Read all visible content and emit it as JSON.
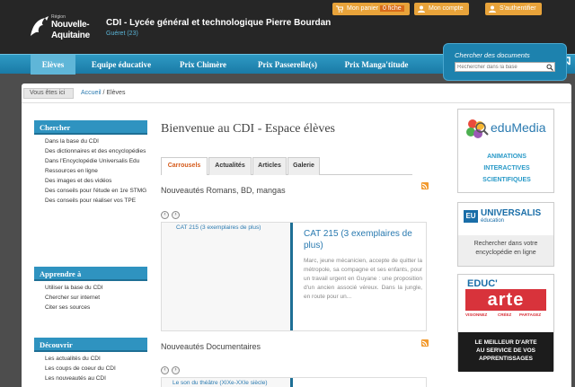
{
  "header": {
    "buttons": {
      "cart_label": "Mon panier",
      "cart_badge": "0 fiche",
      "account_label": "Mon compte",
      "login_label": "S'authentifier"
    },
    "logo": {
      "region_small": "Région",
      "region_line1": "Nouvelle-",
      "region_line2": "Aquitaine"
    },
    "title": "CDI - Lycée général et technologique Pierre Bourdan",
    "subtitle": "Guéret (23)"
  },
  "nav": {
    "items": [
      "Elèves",
      "Equipe éducative",
      "Prix Chimère",
      "Prix Passerelle(s)",
      "Prix Manga'titude"
    ]
  },
  "search": {
    "label": "Chercher des documents",
    "placeholder": "Rechercher dans la base"
  },
  "breadcrumb": {
    "here": "Vous êtes ici",
    "home": "Accueil",
    "separator": "/",
    "current": "Elèves"
  },
  "sidebar": {
    "chercher": {
      "title": "Chercher",
      "items": [
        "Dans la base du CDI",
        "Des dictionnaires et des encyclopédies",
        "Dans l'Encyclopédie Universalis Edu",
        "Ressources en ligne",
        "Des images et des vidéos",
        "Des conseils pour l'étude en 1re STMG",
        "Des conseils pour réaliser vos TPE"
      ]
    },
    "apprendre": {
      "title": "Apprendre à",
      "items": [
        "Utiliser la base du CDI",
        "Chercher sur internet",
        "Citer ses sources"
      ]
    },
    "decouvrir": {
      "title": "Découvrir",
      "items": [
        "Les actualités du CDI",
        "Les coups de coeur du CDI",
        "Les nouveautés au CDI"
      ]
    }
  },
  "main": {
    "heading": "Bienvenue au CDI - Espace élèves",
    "tabs": [
      "Carrousels",
      "Actualités",
      "Articles",
      "Galerie"
    ],
    "section1": {
      "title": "Nouveautés Romans, BD, mangas",
      "thumb_title": "CAT 215 (3 exemplaires de plus)",
      "caption_title": "CAT 215 (3 exemplaires de plus)",
      "caption_text": "Marc, jeune mécanicien, accepte de quitter la métropole, sa compagne et ses enfants, pour un travail urgent en Guyane : une proposition d'un ancien associé véreux. Dans la jungle, en route pour un..."
    },
    "section2": {
      "title": "Nouveautés Documentaires",
      "thumb_title": "Le son du théâtre (XIXe-XXIe siècle)"
    }
  },
  "promos": {
    "edumedia": {
      "word": "eduMedia",
      "line1": "ANIMATIONS",
      "line2": "INTERACTIVES",
      "line3": "SCIENTIFIQUES"
    },
    "universalis": {
      "badge": "EU",
      "word": "UNIVERSALIS",
      "sub": "éducation",
      "line1": "Rechercher dans votre",
      "line2": "encyclopédie en ligne"
    },
    "educarte": {
      "top": "EDUC'",
      "word": "arte",
      "icons": [
        "VISIONNEZ",
        "CRÉEZ",
        "PARTAGEZ"
      ],
      "line1": "LE MEILLEUR D'ARTE",
      "line2": "AU SERVICE DE VOS",
      "line3": "APPRENTISSAGES"
    }
  },
  "colors": {
    "accent_orange": "#e8a33a",
    "nav_blue": "#1a7aa6",
    "link_blue": "#2a7ab0",
    "active_tab": "#d55a1a"
  }
}
